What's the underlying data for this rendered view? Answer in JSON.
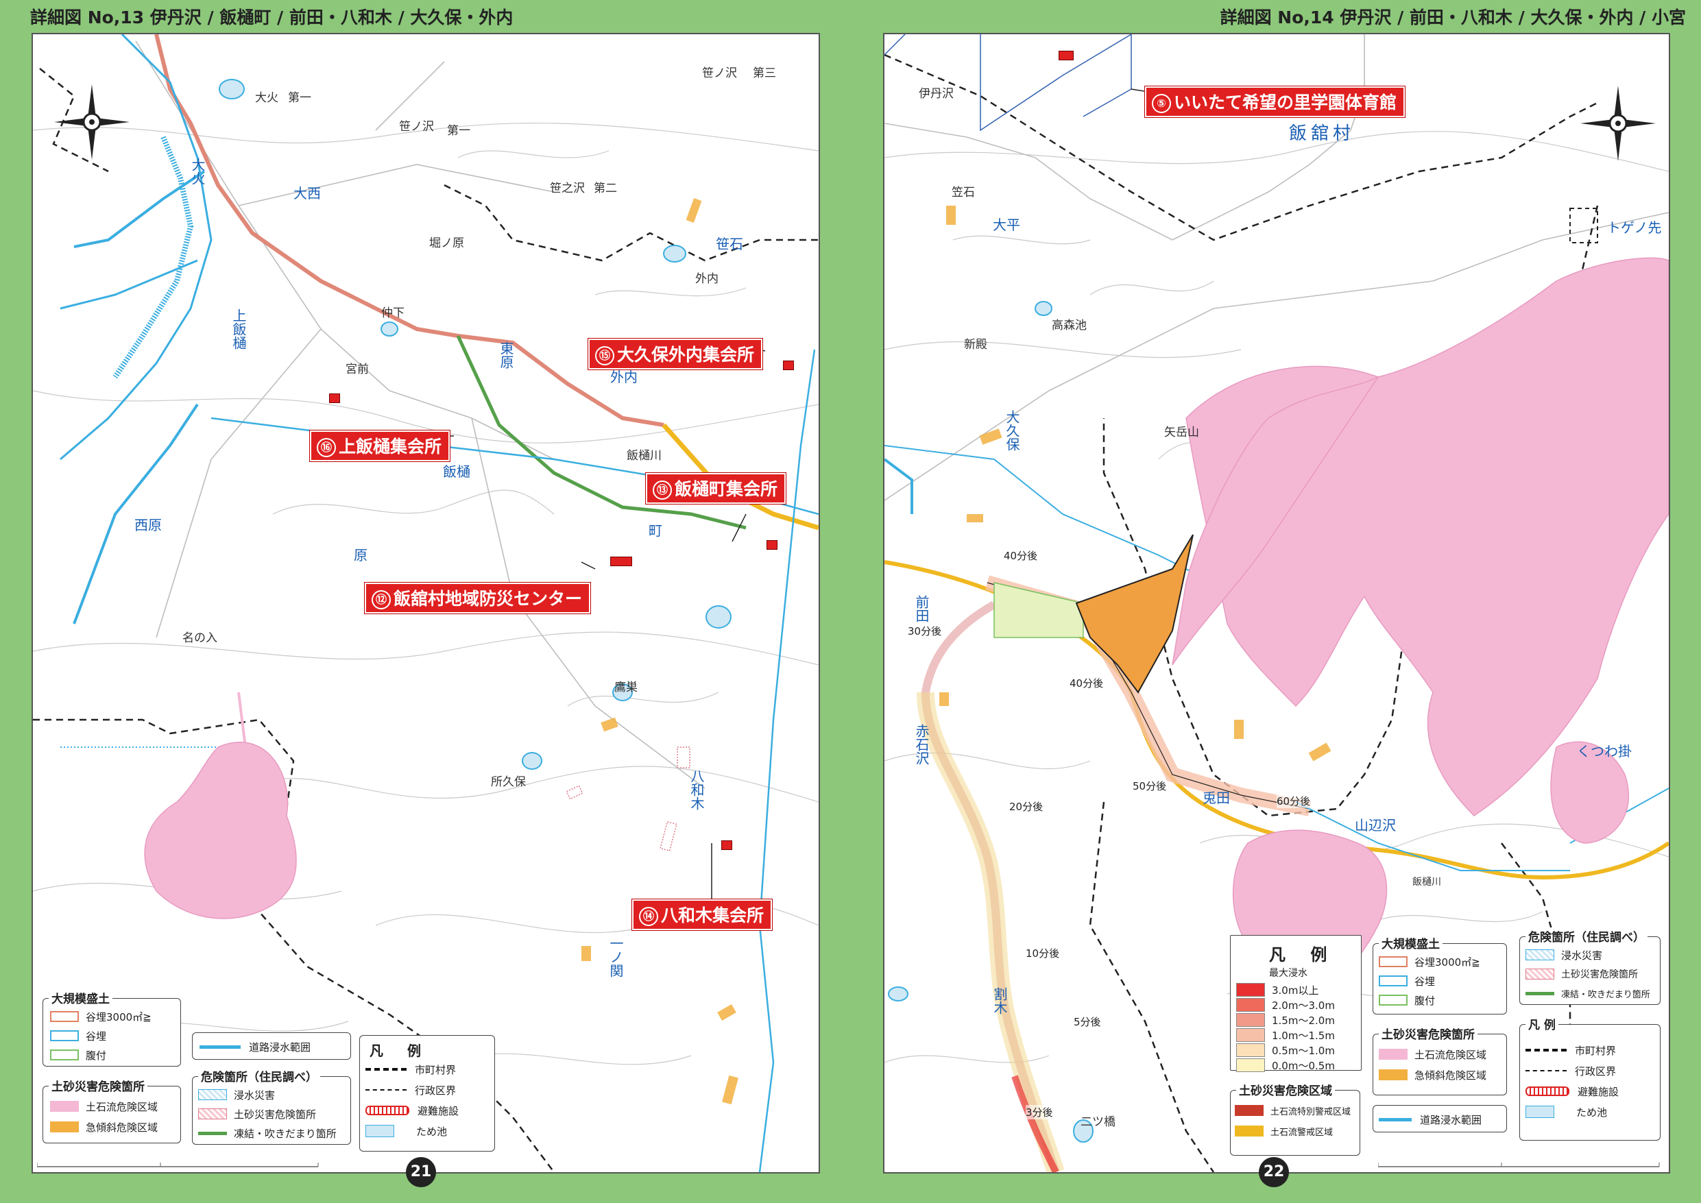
{
  "left": {
    "header": "詳細図 No,13 伊丹沢 / 飯樋町 / 前田・八和木 / 大久保・外内",
    "page_number": "21",
    "facilities": [
      {
        "num": "⑯",
        "name": "上飯樋集会所"
      },
      {
        "num": "⑮",
        "name": "大久保外内集会所"
      },
      {
        "num": "⑬",
        "name": "飯樋町集会所"
      },
      {
        "num": "⑫",
        "name": "飯舘村地域防災センター"
      },
      {
        "num": "⑭",
        "name": "八和木集会所"
      }
    ],
    "places": [
      "大火",
      "第一",
      "笹ノ沢",
      "第一",
      "笹ノ沢",
      "第三",
      "大火",
      "大西",
      "笹之沢",
      "第二",
      "堀ノ原",
      "笹石",
      "外内",
      "上飯樋",
      "仲下",
      "宮前",
      "東原",
      "外内",
      "飯樋",
      "飯樋川",
      "町",
      "西原",
      "原",
      "名の入",
      "鷹巣",
      "所久保",
      "八和木",
      "一ノ関"
    ],
    "legend": {
      "large_fill": {
        "title": "大規模盛土",
        "items": [
          "谷埋3000㎡≧",
          "谷埋",
          "腹付"
        ]
      },
      "sediment": {
        "title": "土砂災害危険箇所",
        "items": [
          "土石流危険区域",
          "急傾斜危険区域"
        ]
      },
      "road_flood": "道路浸水範囲",
      "danger": {
        "title": "危険箇所（住民調べ）",
        "items": [
          "浸水災害",
          "土砂災害危険箇所",
          "凍結・吹きだまり箇所"
        ]
      },
      "hanrei": {
        "title": "凡 例",
        "items": [
          "市町村界",
          "行政区界",
          "避難施設",
          "ため池"
        ]
      }
    }
  },
  "right": {
    "header": "詳細図 No,14 伊丹沢 / 前田・八和木 / 大久保・外内 / 小宮",
    "page_number": "22",
    "facilities": [
      {
        "num": "⑤",
        "name": "いいたて希望の里学園体育館"
      }
    ],
    "places": [
      "伊丹沢",
      "飯舘村",
      "笠石",
      "大平",
      "トゲノ先",
      "高森池",
      "新殿",
      "大久保",
      "矢岳山",
      "前田",
      "赤石沢",
      "兎田",
      "山辺沢",
      "くつわ掛",
      "飯樋川",
      "割木",
      "二ツ橋"
    ],
    "times": [
      "40分後",
      "30分後",
      "40分後",
      "20分後",
      "50分後",
      "60分後",
      "10分後",
      "5分後",
      "3分後"
    ],
    "depth_legend": {
      "title": "凡 例",
      "subtitle": "最大浸水",
      "items": [
        "3.0m以上",
        "2.0m～3.0m",
        "1.5m～2.0m",
        "1.0m～1.5m",
        "0.5m～1.0m",
        "0.0m～0.5m"
      ],
      "colors": [
        "#e83030",
        "#ef6a5a",
        "#f29a8a",
        "#f6c0a8",
        "#fbe0b8",
        "#fdf3c0"
      ]
    },
    "large_fill": {
      "title": "大規模盛土",
      "items": [
        "谷埋3000㎡≧",
        "谷埋",
        "腹付"
      ]
    },
    "sediment_flow": {
      "title": "土砂災害危険区域",
      "items": [
        "土石流特別警戒区域",
        "土石流警戒区域"
      ]
    },
    "sediment": {
      "title": "土砂災害危険箇所",
      "items": [
        "土石流危険区域",
        "急傾斜危険区域"
      ]
    },
    "road_flood": "道路浸水範囲",
    "danger": {
      "title": "危険箇所（住民調べ）",
      "items": [
        "浸水災害",
        "土砂災害危険箇所",
        "凍結・吹きだまり箇所"
      ]
    },
    "hanrei": {
      "title": "凡 例",
      "items": [
        "市町村界",
        "行政区界",
        "避難施設",
        "ため池"
      ]
    }
  },
  "colors": {
    "page_bg": "#8cc77a",
    "facility": "#e02020",
    "debris_zone": "#f4b8d4",
    "steep_zone": "#f2b040",
    "road": "#f0b820",
    "river": "#3aaee0",
    "prefecture_road": "#e08878",
    "green_road": "#55a04a"
  }
}
